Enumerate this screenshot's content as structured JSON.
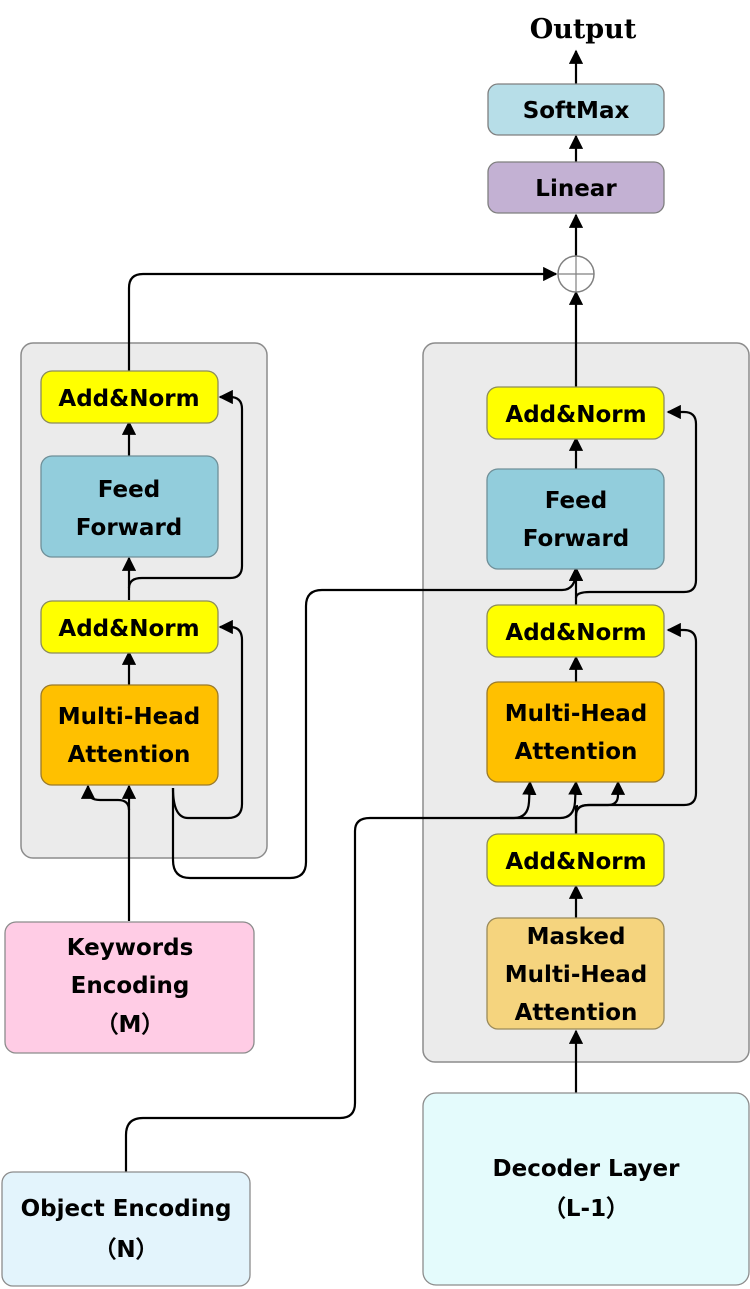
{
  "output_label": "Output",
  "top": {
    "softmax": "SoftMax",
    "linear": "Linear",
    "sum_node": "concatenation-sum"
  },
  "encoder_block": {
    "add_norm_top": "Add&Norm",
    "feed_forward": [
      "Feed",
      "Forward"
    ],
    "add_norm_bottom": "Add&Norm",
    "multi_head_attention": [
      "Multi-Head",
      "Attention"
    ]
  },
  "decoder_block": {
    "add_norm_top": "Add&Norm",
    "feed_forward": [
      "Feed",
      "Forward"
    ],
    "add_norm_middle": "Add&Norm",
    "multi_head_attention": [
      "Multi-Head",
      "Attention"
    ],
    "add_norm_bottom": "Add&Norm",
    "masked_attention": [
      "Masked",
      "Multi-Head",
      "Attention"
    ]
  },
  "inputs": {
    "keywords": [
      "Keywords",
      "Encoding",
      "（M）"
    ],
    "object": [
      "Object Encoding",
      "（N）"
    ],
    "decoder_layer": [
      "Decoder Layer",
      "（L-1）"
    ]
  },
  "colors": {
    "add_norm": "#FFFF00",
    "feed_forward": "#92CDDC",
    "attention": "#FFC000",
    "masked_attention": "#F5D47E",
    "softmax": "#B7DEE8",
    "linear": "#C3B1D3",
    "keywords": "#FFCCE5",
    "object": "#E3F4FC",
    "decoder_layer": "#E4FBFC",
    "block_bg": "#EBEBEB"
  }
}
